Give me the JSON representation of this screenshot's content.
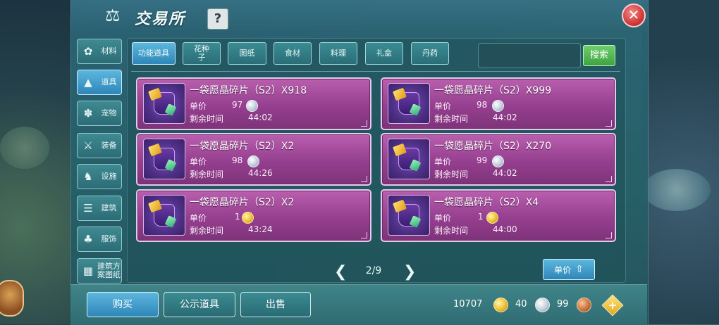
{
  "header": {
    "title": "交易所",
    "help_label": "?",
    "close_label": "✕"
  },
  "sidebar": {
    "items": [
      {
        "label": "材料",
        "icon": "flower-icon"
      },
      {
        "label": "道具",
        "icon": "potion-icon",
        "active": true
      },
      {
        "label": "宠物",
        "icon": "paw-icon"
      },
      {
        "label": "装备",
        "icon": "sword-icon"
      },
      {
        "label": "设施",
        "icon": "horse-icon"
      },
      {
        "label": "建筑",
        "icon": "building-icon"
      },
      {
        "label": "服饰",
        "icon": "shirt-icon"
      },
      {
        "label": "建筑方案图纸",
        "icon": "blueprint-icon"
      }
    ]
  },
  "tabs": [
    {
      "label": "功能道具",
      "active": true
    },
    {
      "label": "花种子"
    },
    {
      "label": "图纸"
    },
    {
      "label": "食材"
    },
    {
      "label": "料理"
    },
    {
      "label": "礼盒"
    },
    {
      "label": "丹药"
    }
  ],
  "search": {
    "button_label": "搜索",
    "value": ""
  },
  "listing": {
    "price_label": "单价",
    "time_label": "剩余时间",
    "items": [
      {
        "name": "一袋愿晶碎片（S2）X918",
        "price": "97",
        "currency": "silver",
        "time": "44:02"
      },
      {
        "name": "一袋愿晶碎片（S2）X999",
        "price": "98",
        "currency": "silver",
        "time": "44:02"
      },
      {
        "name": "一袋愿晶碎片（S2）X2",
        "price": "98",
        "currency": "silver",
        "time": "44:26"
      },
      {
        "name": "一袋愿晶碎片（S2）X270",
        "price": "99",
        "currency": "silver",
        "time": "44:02"
      },
      {
        "name": "一袋愿晶碎片（S2）X2",
        "price": "1",
        "currency": "gold",
        "time": "43:24"
      },
      {
        "name": "一袋愿晶碎片（S2）X4",
        "price": "1",
        "currency": "gold",
        "time": "44:00"
      }
    ]
  },
  "pagination": {
    "text": "2/9",
    "prev": "❮",
    "next": "❯"
  },
  "sort": {
    "label": "单价",
    "direction_icon": "⇧"
  },
  "actions": {
    "buy": "购买",
    "public": "公示道具",
    "sell": "出售"
  },
  "currency": {
    "gold": "10707",
    "silver": "40",
    "bronze": "99",
    "add": "+"
  }
}
